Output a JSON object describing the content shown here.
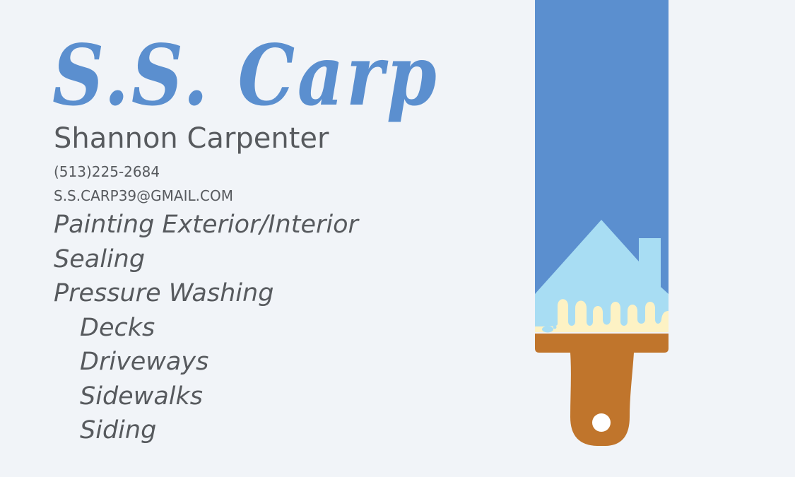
{
  "card": {
    "logo_text": "S.S. Carp",
    "owner_name": "Shannon Carpenter",
    "phone": "(513)225-2684",
    "email": "S.S.CARP39@GMAIL.COM",
    "services": [
      {
        "label": "Painting Exterior/Interior",
        "indent": false
      },
      {
        "label": "Sealing",
        "indent": false
      },
      {
        "label": "Pressure Washing",
        "indent": false
      },
      {
        "label": "Decks",
        "indent": true
      },
      {
        "label": "Driveways",
        "indent": true
      },
      {
        "label": "Sidewalks",
        "indent": true
      },
      {
        "label": "Siding",
        "indent": true
      }
    ]
  },
  "colors": {
    "background": "#f1f4f8",
    "accent_blue": "#5b8fcf",
    "light_blue": "#a8ddf3",
    "cream": "#fdf2c4",
    "handle_brown": "#c0752c",
    "text_gray": "#575a5e"
  },
  "icons": {
    "brush": "paintbrush-icon",
    "house": "house-icon"
  }
}
